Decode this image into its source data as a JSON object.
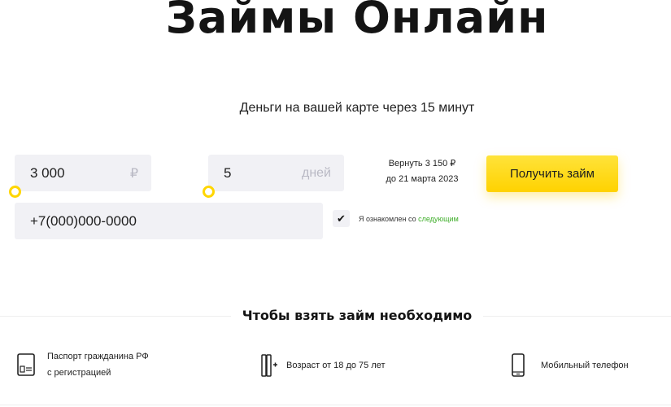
{
  "hero": {
    "title": "Займы Онлайн",
    "subtitle": "Деньги на вашей карте через 15 минут"
  },
  "form": {
    "amount": {
      "value": "3 000",
      "suffix": "₽"
    },
    "days": {
      "value": "5",
      "suffix": "дней"
    },
    "phone": {
      "value": "+7(000)000-0000"
    },
    "repay": {
      "line1": "Вернуть 3 150 ₽",
      "line2": "до 21 марта 2023"
    },
    "submit_label": "Получить займ",
    "consent": {
      "checked": true,
      "checkmark": "✔",
      "text": "Я ознакомлен со",
      "link": "следующим"
    }
  },
  "requirements": {
    "title": "Чтобы взять займ необходимо",
    "items": [
      {
        "icon": "passport-icon",
        "line1": "Паспорт гражданина РФ",
        "line2": "с регистрацией"
      },
      {
        "icon": "age-icon",
        "line1": "Возраст от 18 до 75 лет"
      },
      {
        "icon": "mobile-phone-icon",
        "line1": "Мобильный телефон"
      }
    ]
  },
  "colors": {
    "accent": "#ffd600",
    "link": "#3fae2a",
    "field_bg": "#f1f1f5"
  }
}
